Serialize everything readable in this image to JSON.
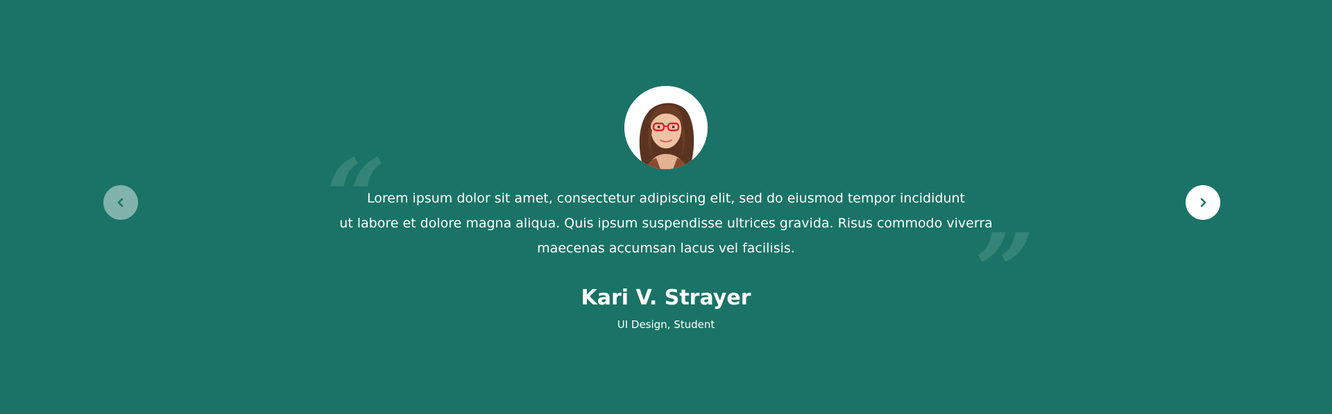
{
  "testimonial": {
    "quote_lines": [
      "Lorem ipsum dolor sit amet, consectetur adipiscing elit, sed do eiusmod tempor incididunt",
      "ut labore et dolore magna aliqua. Quis ipsum suspendisse ultrices gravida. Risus commodo viverra",
      "maecenas accumsan lacus vel facilisis."
    ],
    "author_name": "Kari V. Strayer",
    "author_role": "UI Design, Student",
    "quote_open_glyph": "“",
    "quote_close_glyph": "”"
  },
  "navigation": {
    "prev_icon": "chevron-left-icon",
    "next_icon": "chevron-right-icon"
  },
  "colors": {
    "background": "#1a7366",
    "text": "#ffffff",
    "accent": "#1a7366"
  }
}
